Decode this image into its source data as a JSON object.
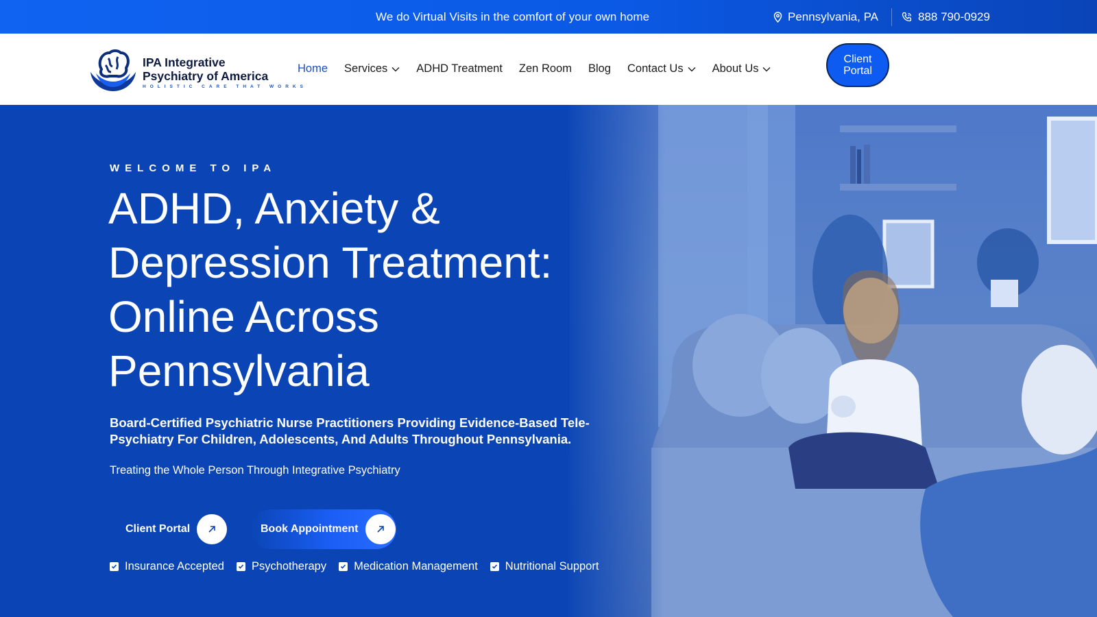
{
  "topbar": {
    "tagline": "We do Virtual Visits in the comfort of your own home",
    "location": "Pennsylvania, PA",
    "phone": "888 790-0929",
    "location_icon": "map-pin-icon",
    "phone_icon": "phone-icon"
  },
  "brand": {
    "title_line1": "IPA Integrative",
    "title_line2": "Psychiatry of America",
    "subtitle": "HOLISTIC CARE THAT WORKS",
    "logo_icon": "brain-logo-icon"
  },
  "nav": {
    "items": [
      {
        "label": "Home",
        "active": true,
        "dropdown": false
      },
      {
        "label": "Services",
        "active": false,
        "dropdown": true
      },
      {
        "label": "ADHD Treatment",
        "active": false,
        "dropdown": false
      },
      {
        "label": "Zen Room",
        "active": false,
        "dropdown": false
      },
      {
        "label": "Blog",
        "active": false,
        "dropdown": false
      },
      {
        "label": "Contact Us",
        "active": false,
        "dropdown": true
      },
      {
        "label": "About Us",
        "active": false,
        "dropdown": true
      }
    ],
    "portal_line1": "Client",
    "portal_line2": "Portal"
  },
  "hero": {
    "eyebrow": "WELCOME TO IPA",
    "headline": "ADHD, Anxiety & Depression Treatment: Online Across Pennsylvania",
    "subhead": "Board-Certified Psychiatric Nurse Practitioners Providing Evidence-Based Tele-Psychiatry For Children, Adolescents, And Adults Throughout Pennsylvania.",
    "tagline": "Treating the Whole Person Through Integrative Psychiatry",
    "cta_primary": "Client Portal",
    "cta_secondary": "Book Appointment",
    "features": [
      "Insurance Accepted",
      "Psychotherapy",
      "Medication Management",
      "Nutritional Support"
    ]
  },
  "colors": {
    "topbar": "#0f63f0",
    "hero_bg": "#0b45b5",
    "accent": "#0d5bf0",
    "brand_navy": "#0d1b3f"
  }
}
